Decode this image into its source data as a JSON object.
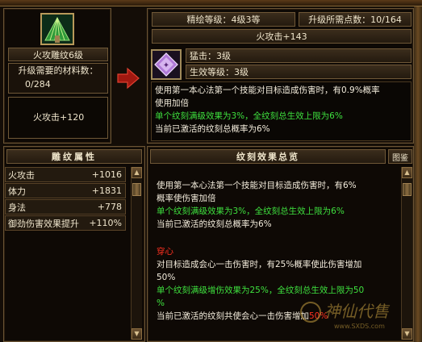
{
  "item": {
    "name": "火攻雕纹6级",
    "materials_label": "升级需要的材料数：",
    "materials_value": "0/284",
    "current_stat": "火攻击+120"
  },
  "upgrade": {
    "level_label": "精绘等级：4级3等",
    "points_label": "升级所需点数：10/164",
    "next_stat": "火攻击+143",
    "sub_attr_1": "猛击：3级",
    "sub_attr_2": "生效等级：3级",
    "effect_lines": [
      "使用第一本心法第一个技能对目标造成伤害时，有0.9%概率",
      "使用加倍",
      "单个纹刻满级效果为3%，全纹刻总生效上限为6%",
      "当前已激活的纹刻总概率为6%"
    ]
  },
  "attributes": {
    "title": "雕纹属性",
    "rows": [
      {
        "name": "火攻击",
        "value": "+1016"
      },
      {
        "name": "体力",
        "value": "+1831"
      },
      {
        "name": "身法",
        "value": "+778"
      },
      {
        "name": "御劲伤害效果提升",
        "value": "+110%"
      }
    ]
  },
  "overview": {
    "title": "纹刻效果总览",
    "tab_label": "图鉴",
    "section1": [
      "使用第一本心法第一个技能对目标造成伤害时，有6%",
      "概率使伤害加倍",
      "单个纹刻满级效果为3%，全纹刻总生效上限为6%",
      "当前已激活的纹刻总概率为6%"
    ],
    "section2_title": "穿心",
    "section2": [
      "对目标造成会心一击伤害时，有25%概率使此伤害增加",
      "50%",
      "单个纹刻满级增伤效果为25%，全纹刻总生效上限为50",
      "%",
      "当前已激活的纹刻共使会心一击伤害增加",
      "50%"
    ]
  },
  "watermark": {
    "brand": "神仙代售",
    "url": "www.SXDS.com"
  },
  "colors": {
    "effect_white": "#f3ecdc",
    "effect_green": "#3ee03e",
    "section_red": "#ff3020",
    "border_gold": "#6f5837"
  },
  "icons": {
    "item_icon": "green-feather-fan-icon",
    "gem_icon": "purple-diamond-glyph-icon",
    "arrow_icon": "red-arrow-right-icon"
  }
}
